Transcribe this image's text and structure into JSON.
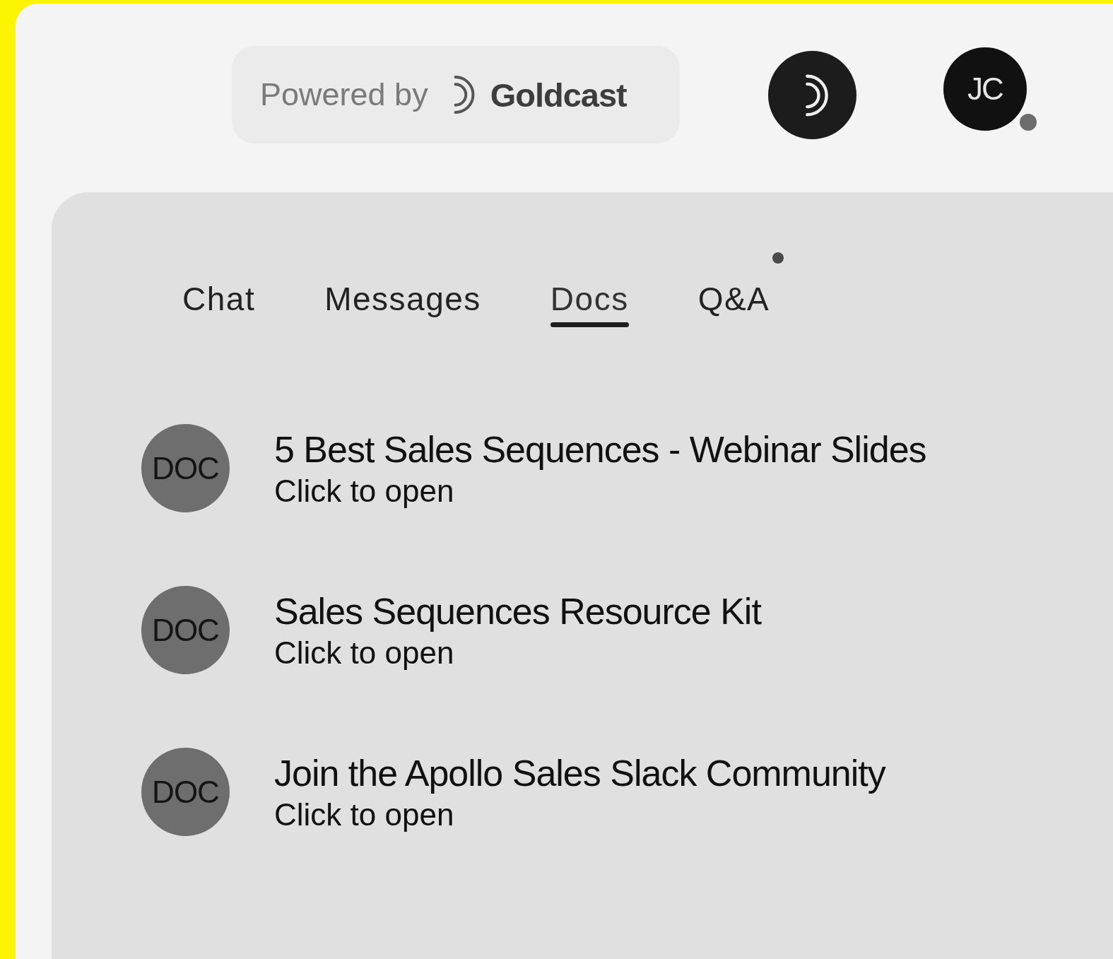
{
  "header": {
    "powered_by": "Powered by",
    "brand": "Goldcast",
    "avatar": {
      "initials": "JC"
    }
  },
  "tabs": [
    {
      "label": "Chat",
      "selected": false,
      "notification": false
    },
    {
      "label": "Messages",
      "selected": false,
      "notification": false
    },
    {
      "label": "Docs",
      "selected": true,
      "notification": false
    },
    {
      "label": "Q&A",
      "selected": false,
      "notification": true
    }
  ],
  "docs": [
    {
      "icon": "DOC",
      "title": "5 Best Sales Sequences - Webinar Slides",
      "subtitle": "Click to open"
    },
    {
      "icon": "DOC",
      "title": "Sales Sequences Resource Kit",
      "subtitle": "Click to open"
    },
    {
      "icon": "DOC",
      "title": "Join the Apollo Sales Slack Community",
      "subtitle": "Click to open"
    }
  ]
}
